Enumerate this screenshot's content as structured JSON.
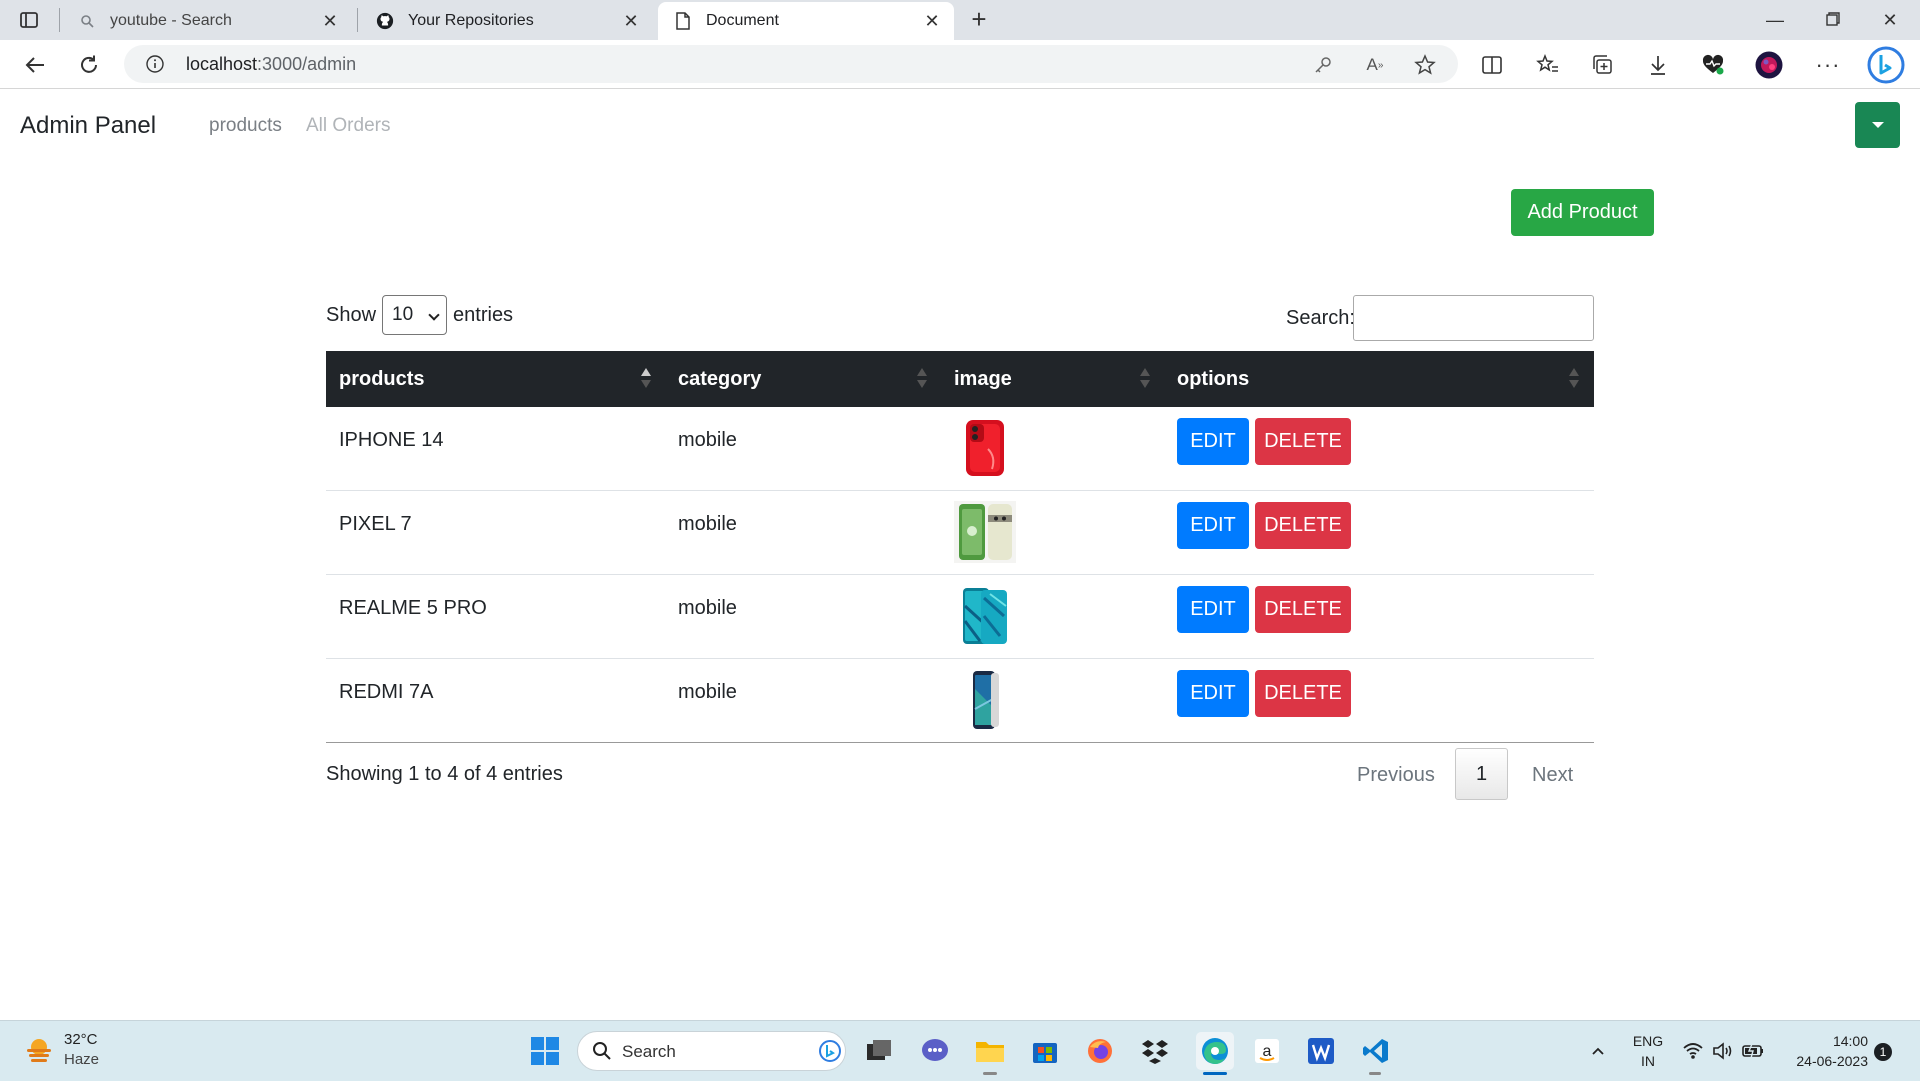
{
  "browser": {
    "tabs": [
      {
        "title": "youtube - Search",
        "icon": "search-icon"
      },
      {
        "title": "Your Repositories",
        "icon": "github-icon"
      },
      {
        "title": "Document",
        "icon": "document-icon"
      }
    ],
    "url_host": "localhost",
    "url_rest": ":3000/admin"
  },
  "navbar": {
    "brand": "Admin Panel",
    "links": [
      "products",
      "All Orders"
    ]
  },
  "toolbar": {
    "add_label": "Add Product"
  },
  "table_controls": {
    "show_label": "Show",
    "entries_value": "10",
    "entries_label": "entries",
    "search_label": "Search:"
  },
  "table": {
    "columns": [
      "products",
      "category",
      "image",
      "options"
    ],
    "rows": [
      {
        "product": "IPHONE 14",
        "category": "mobile",
        "image": "red phone"
      },
      {
        "product": "PIXEL 7",
        "category": "mobile",
        "image": "green phone"
      },
      {
        "product": "REALME 5 PRO",
        "category": "mobile",
        "image": "teal phone"
      },
      {
        "product": "REDMI 7A",
        "category": "mobile",
        "image": "blue phone"
      }
    ],
    "edit_label": "EDIT",
    "delete_label": "DELETE"
  },
  "pagination": {
    "info": "Showing 1 to 4 of 4 entries",
    "previous": "Previous",
    "current": "1",
    "next": "Next"
  },
  "taskbar": {
    "temp": "32°C",
    "weather": "Haze",
    "search_placeholder": "Search",
    "lang_top": "ENG",
    "lang_bottom": "IN",
    "time": "14:00",
    "date": "24-06-2023",
    "notifications": "1"
  },
  "colors": {
    "add": "#28a745",
    "edit": "#007bff",
    "delete": "#dc3545",
    "header": "#212529"
  }
}
